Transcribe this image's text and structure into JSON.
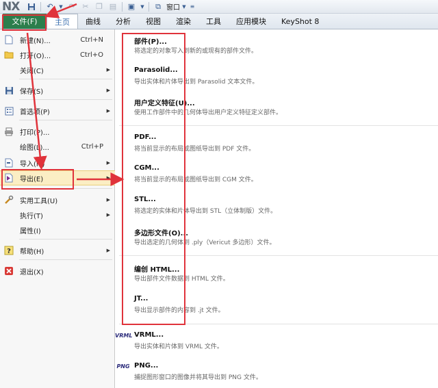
{
  "app": {
    "logo": "NX"
  },
  "qat": {
    "window_label": "窗口"
  },
  "tabs": [
    {
      "label": "文件(F)"
    },
    {
      "label": "主页"
    },
    {
      "label": "曲线"
    },
    {
      "label": "分析"
    },
    {
      "label": "视图"
    },
    {
      "label": "渲染"
    },
    {
      "label": "工具"
    },
    {
      "label": "应用模块"
    },
    {
      "label": "KeyShot 8"
    }
  ],
  "menu": {
    "items": [
      {
        "label": "新建(N)...",
        "shortcut": "Ctrl+N",
        "icon": "new-file-icon"
      },
      {
        "label": "打开(O)...",
        "shortcut": "Ctrl+O",
        "icon": "open-folder-icon"
      },
      {
        "label": "关闭(C)",
        "icon": ""
      },
      {
        "label": "保存(S)",
        "icon": "save-icon"
      },
      {
        "label": "首选项(P)",
        "icon": "preferences-icon"
      },
      {
        "label": "打印(P)...",
        "icon": "printer-icon"
      },
      {
        "label": "绘图(L)...",
        "shortcut": "Ctrl+P",
        "icon": ""
      },
      {
        "label": "导入(M)",
        "icon": "import-icon"
      },
      {
        "label": "导出(E)",
        "icon": "export-icon"
      },
      {
        "label": "实用工具(U)",
        "icon": "utilities-icon"
      },
      {
        "label": "执行(T)",
        "icon": ""
      },
      {
        "label": "属性(I)",
        "icon": ""
      },
      {
        "label": "帮助(H)",
        "icon": "help-icon"
      },
      {
        "label": "退出(X)",
        "icon": "exit-icon"
      }
    ]
  },
  "submenu": {
    "items": [
      {
        "title": "部件(P)...",
        "desc": "将选定的对象写入到新的或现有的部件文件。"
      },
      {
        "title": "Parasolid...",
        "desc": "导出实体和片体导出到 Parasolid 文本文件。"
      },
      {
        "title": "用户定义特征(U)...",
        "desc": "使用工作部件中的几何体导出用户定义特征定义部件。"
      },
      {
        "title": "PDF...",
        "desc": "将当前显示的布局或图纸导出到 PDF 文件。"
      },
      {
        "title": "CGM...",
        "desc": "将当前显示的布局或图纸导出到 CGM 文件。"
      },
      {
        "title": "STL...",
        "desc": "将选定的实体和片体导出到 STL（立体制版）文件。"
      },
      {
        "title": "多边形文件(O)...",
        "desc": "导出选定的几何体到 .ply（Vericut 多边形）文件。"
      },
      {
        "title": "编创 HTML...",
        "desc": "导出部件文件数据到 HTML 文件。"
      },
      {
        "title": "JT...",
        "desc": "导出显示部件的内容到 .jt 文件。"
      },
      {
        "title": "VRML...",
        "desc": "导出实体和片体到 VRML 文件。",
        "icon_text": "VRML"
      },
      {
        "title": "PNG...",
        "desc": "捕捉图形窗口的图像并将其导出到 PNG 文件。",
        "icon_text": "PNG"
      }
    ]
  }
}
